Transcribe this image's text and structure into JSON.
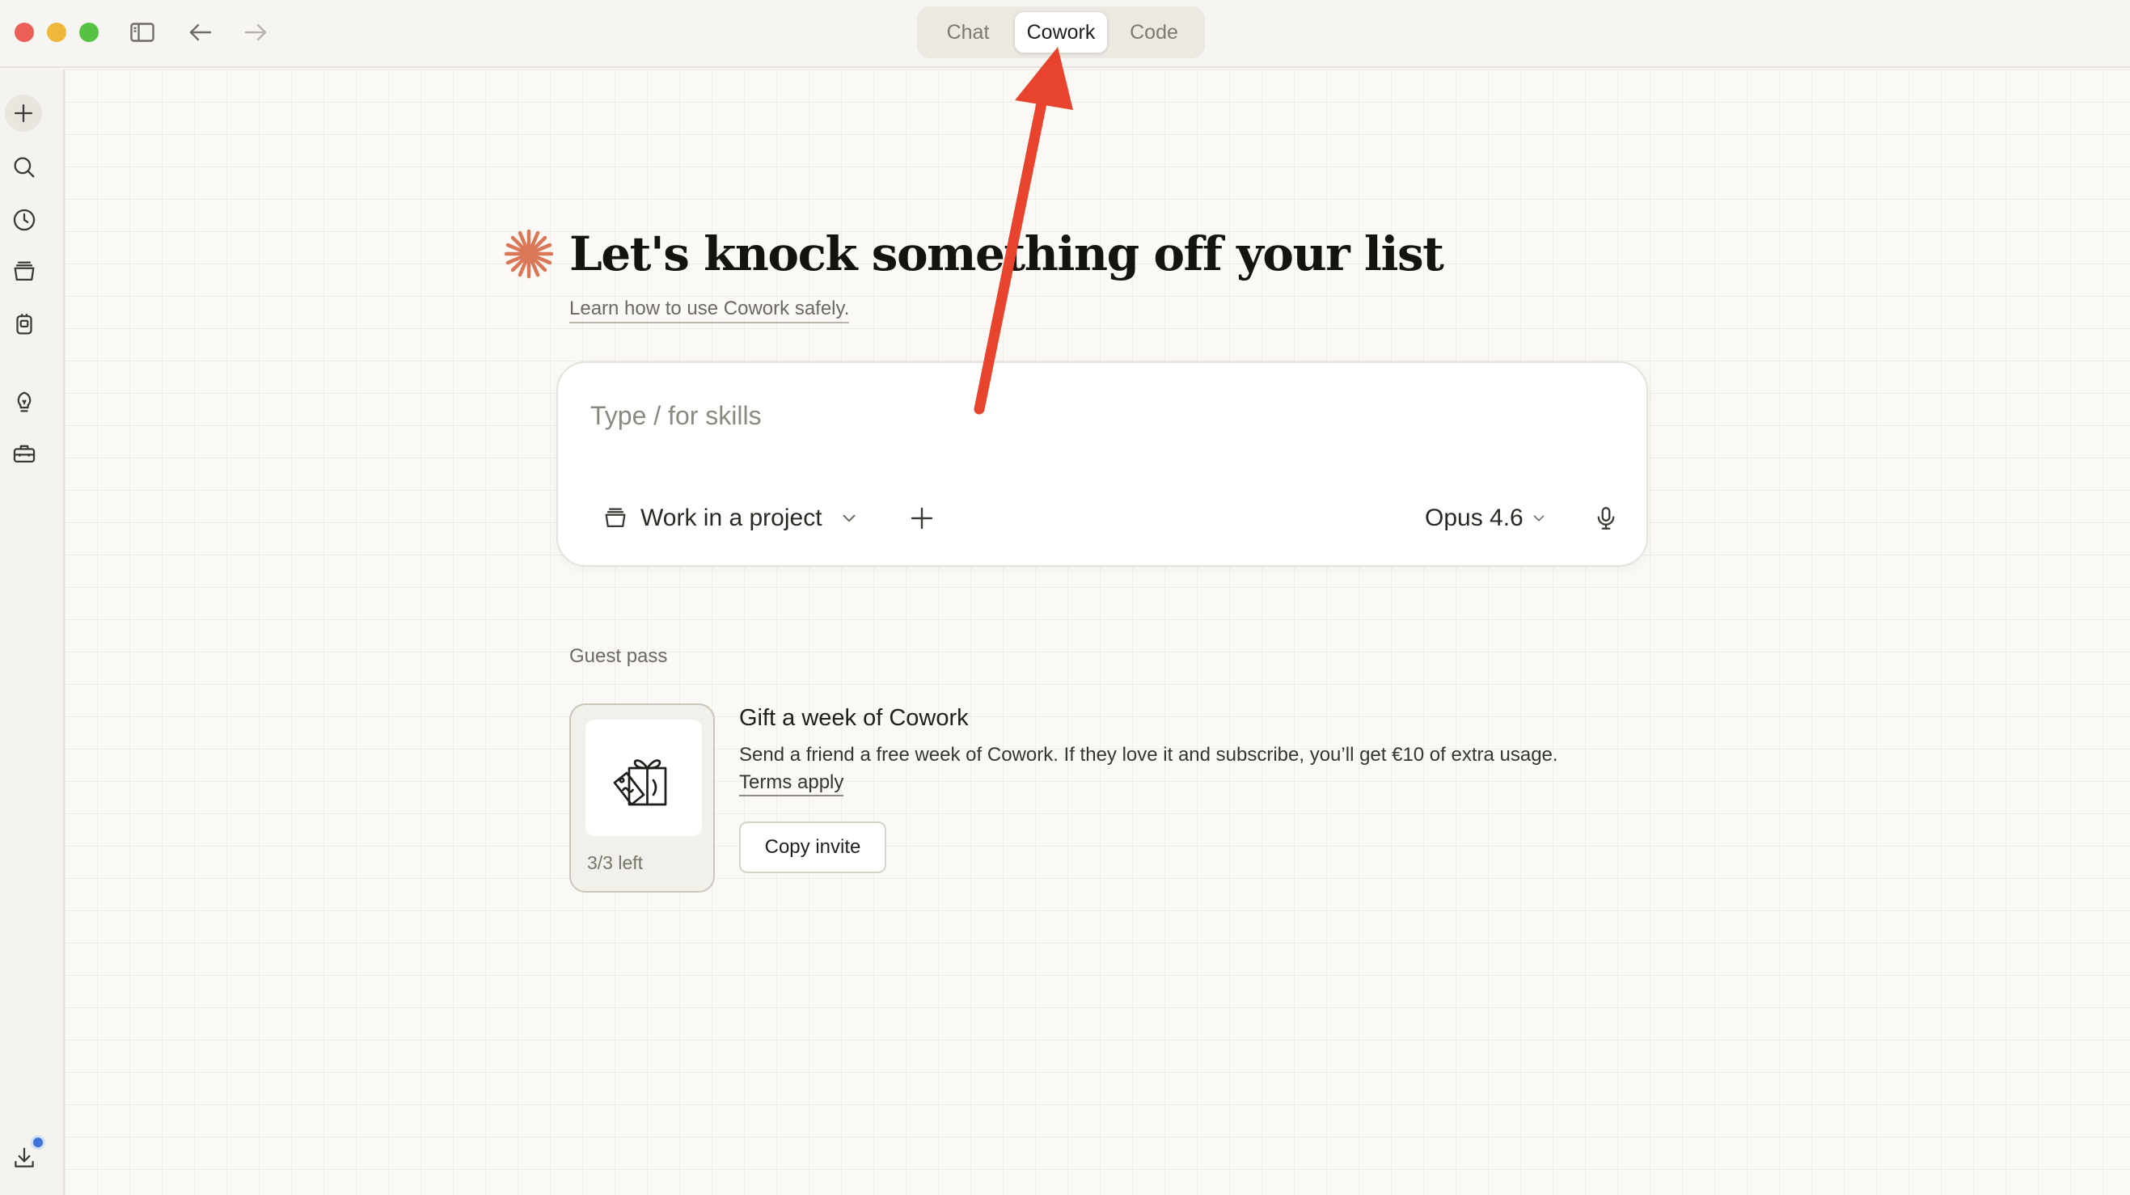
{
  "titlebar": {
    "tabs": [
      {
        "label": "Chat",
        "active": false
      },
      {
        "label": "Cowork",
        "active": true
      },
      {
        "label": "Code",
        "active": false
      }
    ]
  },
  "sidebar": {
    "items": [
      {
        "icon": "plus-icon",
        "name": "new-task"
      },
      {
        "icon": "search-icon",
        "name": "search"
      },
      {
        "icon": "clock-icon",
        "name": "history"
      },
      {
        "icon": "projects-icon",
        "name": "projects"
      },
      {
        "icon": "artifacts-icon",
        "name": "artifacts"
      },
      {
        "icon": "lightbulb-icon",
        "name": "ideas"
      },
      {
        "icon": "toolbox-icon",
        "name": "tools"
      },
      {
        "icon": "download-icon",
        "name": "download"
      }
    ]
  },
  "hero": {
    "title": "Let's knock something off your list",
    "link": "Learn how to use Cowork safely."
  },
  "composer": {
    "placeholder": "Type / for skills",
    "project_label": "Work in a project",
    "model_label": "Opus 4.6"
  },
  "guest_pass": {
    "section_label": "Guest pass",
    "count": "3/3 left",
    "title": "Gift a week of Cowork",
    "description": "Send a friend a free week of Cowork. If they love it and subscribe, you’ll get €10 of extra usage.",
    "terms": "Terms apply",
    "button": "Copy invite"
  },
  "colors": {
    "accent": "#d97757",
    "annotation_arrow": "#e8432d",
    "notification_dot": "#3f72d6"
  }
}
